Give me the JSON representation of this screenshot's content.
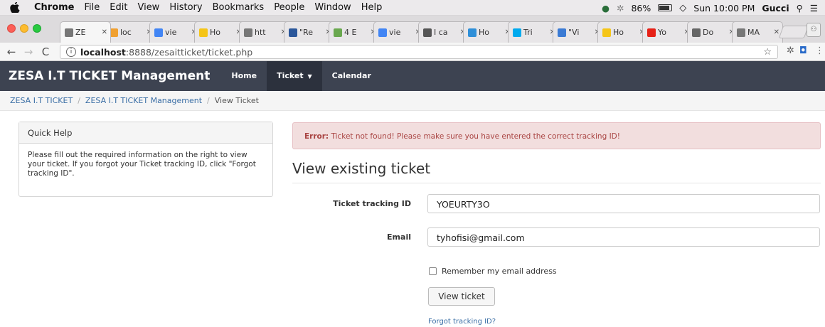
{
  "os_menubar": {
    "app": "Chrome",
    "items": [
      "File",
      "Edit",
      "View",
      "History",
      "Bookmarks",
      "People",
      "Window",
      "Help"
    ],
    "battery": "86%",
    "clock": "Sun 10:00 PM",
    "user": "Gucci"
  },
  "tabs": [
    {
      "title": "ZE",
      "color": "#777777"
    },
    {
      "title": "loc",
      "color": "#f0a030"
    },
    {
      "title": "vie",
      "color": "#4285f4"
    },
    {
      "title": "Ho",
      "color": "#f5c518"
    },
    {
      "title": "htt",
      "color": "#777777"
    },
    {
      "title": "\"Re",
      "color": "#2b579a"
    },
    {
      "title": "4 E",
      "color": "#6aa84f"
    },
    {
      "title": "vie",
      "color": "#4285f4"
    },
    {
      "title": "I ca",
      "color": "#555555"
    },
    {
      "title": "Ho",
      "color": "#2f8fd8"
    },
    {
      "title": "Tri",
      "color": "#00aaee"
    },
    {
      "title": "\"Vi",
      "color": "#3b7bd4"
    },
    {
      "title": "Ho",
      "color": "#f5c518"
    },
    {
      "title": "Yo",
      "color": "#e62117"
    },
    {
      "title": "Do",
      "color": "#666666"
    },
    {
      "title": "MA",
      "color": "#777777"
    }
  ],
  "address": {
    "host": "localhost",
    "rest": ":8888/zesaitticket/ticket.php"
  },
  "navbar": {
    "brand": "ZESA I.T TICKET Management",
    "home": "Home",
    "ticket": "Ticket",
    "calendar": "Calendar"
  },
  "breadcrumb": {
    "item1": "ZESA I.T TICKET",
    "item2": "ZESA I.T TICKET Management",
    "current": "View Ticket"
  },
  "quick_help": {
    "title": "Quick Help",
    "body": "Please fill out the required information on the right to view your ticket. If you forgot your Ticket tracking ID, click \"Forgot tracking ID\"."
  },
  "alert": {
    "label": "Error:",
    "message": "Ticket not found! Please make sure you have entered the correct tracking ID!"
  },
  "form": {
    "heading": "View existing ticket",
    "tracking_label": "Ticket tracking ID",
    "tracking_value": "YOEURTY3O",
    "email_label": "Email",
    "email_value": "tyhofisi@gmail.com",
    "remember_label": "Remember my email address",
    "submit_label": "View ticket",
    "forgot_link": "Forgot tracking ID?"
  }
}
